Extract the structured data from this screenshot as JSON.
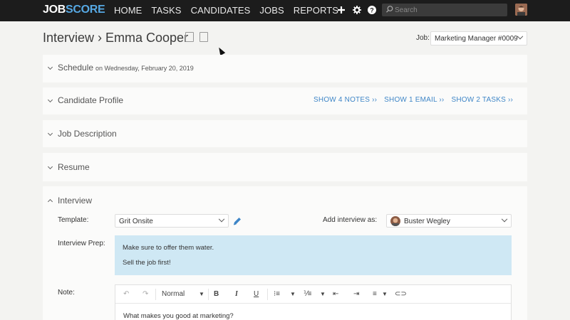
{
  "brand": {
    "logo_a": "JOB",
    "logo_b": "SCORE"
  },
  "nav": [
    "HOME",
    "TASKS",
    "CANDIDATES",
    "JOBS",
    "REPORTS"
  ],
  "search": {
    "placeholder": "Search"
  },
  "header": {
    "title": "Interview › Emma Cooper",
    "job_label": "Job:",
    "job_value": "Marketing Manager #0009"
  },
  "sections": {
    "schedule": {
      "label": "Schedule",
      "sub": "on Wednesday, February 20, 2019"
    },
    "profile": {
      "label": "Candidate Profile",
      "links": [
        "SHOW 4 NOTES ››",
        "SHOW 1 EMAIL ››",
        "SHOW 2 TASKS ››"
      ]
    },
    "job_description": {
      "label": "Job Description"
    },
    "resume": {
      "label": "Resume"
    },
    "interview": {
      "label": "Interview",
      "template_label": "Template:",
      "template_value": "Grit Onsite",
      "add_as_label": "Add interview as:",
      "add_as_value": "Buster Wegley",
      "prep_label": "Interview Prep:",
      "prep_lines": [
        "Make sure to offer them water.",
        "Sell the job first!"
      ],
      "note_label": "Note:",
      "format_value": "Normal",
      "note_text": "What makes you good at marketing?"
    }
  },
  "colors": {
    "accent": "#3f86c7",
    "topbar": "#1c1c1c",
    "prep_bg": "#cfe8f4"
  }
}
